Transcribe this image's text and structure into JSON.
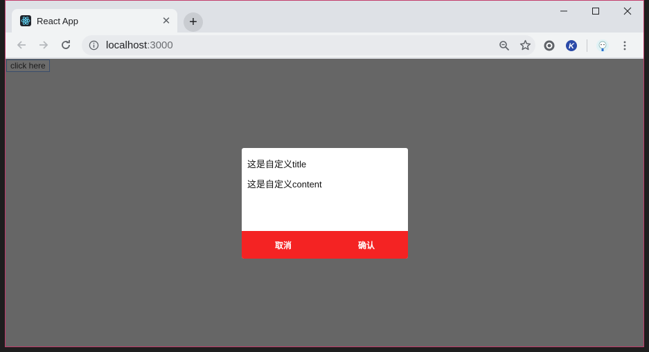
{
  "browser": {
    "tab": {
      "title": "React App",
      "close_glyph": "✕"
    },
    "new_tab_glyph": "+",
    "window_controls": {
      "minimize": "—",
      "maximize": "☐",
      "close": "✕"
    },
    "address": {
      "host": "localhost",
      "port": ":3000"
    }
  },
  "page": {
    "click_button_label": "click here",
    "modal": {
      "title": "这是自定义title",
      "content": "这是自定义content",
      "cancel_label": "取消",
      "confirm_label": "确认",
      "footer_color": "#f42323"
    },
    "overlay_color": "#666666"
  },
  "icons": [
    "react-favicon-icon",
    "back-arrow-icon",
    "forward-arrow-icon",
    "reload-icon",
    "info-icon",
    "zoom-icon",
    "star-icon",
    "extension-icon",
    "k-extension-icon",
    "profile-avatar-icon",
    "menu-dots-icon"
  ]
}
